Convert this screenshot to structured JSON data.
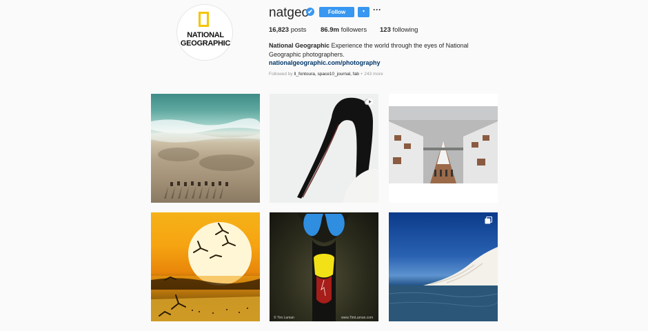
{
  "profile": {
    "logo_line1": "NATIONAL",
    "logo_line2": "GEOGRAPHIC",
    "username": "natgeo",
    "verified_mark": "✔",
    "follow_label": "Follow",
    "dropdown_glyph": "▾",
    "more_glyph": "···"
  },
  "stats": {
    "posts_count": "16,823",
    "posts_label": "posts",
    "followers_count": "86.9m",
    "followers_label": "followers",
    "following_count": "123",
    "following_label": "following"
  },
  "bio": {
    "name": "National Geographic",
    "text": "Experience the world through the eyes of National Geographic photographers.",
    "link": "nationalgeographic.com/photography",
    "followed_by_prefix": "Followed by",
    "followed_by_users": "ll_fontoura, space10_journal, fab",
    "followed_by_more": "+ 243 more"
  },
  "posts": [
    {
      "icon": "none"
    },
    {
      "icon": "video-icon"
    },
    {
      "icon": "none"
    },
    {
      "icon": "none"
    },
    {
      "icon": "none",
      "credit_left": "© Tim Laman",
      "credit_right": "www.TimLaman.com"
    },
    {
      "icon": "multiple-photos-icon"
    }
  ],
  "colors": {
    "accent": "#3897f0",
    "logo_yellow": "#f5c400",
    "link": "#003569",
    "background": "#fafafa"
  }
}
